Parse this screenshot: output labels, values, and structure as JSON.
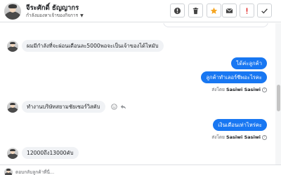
{
  "header": {
    "contact_name": "จีระศักดิ์ ธัญญากร",
    "status_label": "กำลังมองหาเจ้าของกิจการ",
    "accent_color": "#f5a623",
    "toolbar": [
      "alert-circle-icon",
      "trash-icon",
      "star-icon",
      "mail-icon",
      "exclamation-icon",
      "check-icon"
    ]
  },
  "messages": [
    {
      "direction": "in",
      "text": "ผมมีกำลังที่จะผ่อนเดือนละ5000พอจะเป็นเจ้าของได้ไหมับ"
    },
    {
      "direction": "out",
      "text": "ได้ค่ะลูกค้า"
    },
    {
      "direction": "out",
      "text": "ลูกค้าทำเลอร์ชีพอะไรคะ"
    },
    {
      "direction": "meta",
      "prefix": "ส่งโดย",
      "sender": "Sasiwi Sasiwi"
    },
    {
      "direction": "in",
      "text": "ทำงานบริษัทสยามชัยเซอร์วิสคับ"
    },
    {
      "direction": "out",
      "text": "เงินเดือนเท่าไหร่คะ"
    },
    {
      "direction": "meta",
      "prefix": "ส่งโดย",
      "sender": "Sasiwi Sasiwi"
    },
    {
      "direction": "in",
      "text": "12000ถึง13000คับ"
    }
  ],
  "composer": {
    "text": "ตอบกลับลูกค้าที่นี่..."
  },
  "colors": {
    "outgoing_bubble": "#1877f2",
    "incoming_bubble": "#f0f2f5"
  }
}
